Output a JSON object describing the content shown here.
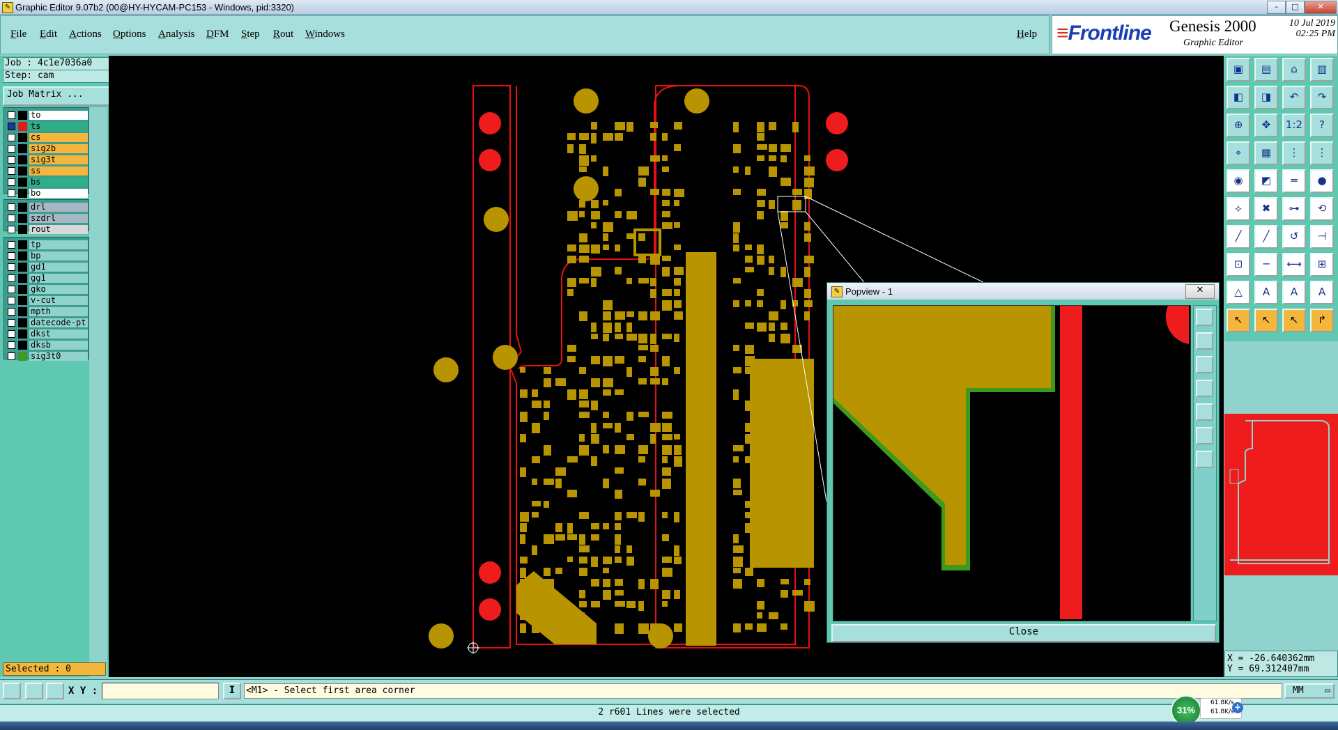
{
  "window": {
    "title": "Graphic Editor 9.07b2 (00@HY-HYCAM-PC153 - Windows, pid:3320)",
    "controls": [
      "–",
      "□",
      "✕"
    ]
  },
  "menu": {
    "items": [
      "File",
      "Edit",
      "Actions",
      "Options",
      "Analysis",
      "DFM",
      "Step",
      "Rout",
      "Windows"
    ],
    "help": "Help"
  },
  "brand": {
    "logo": "Frontline",
    "product": "Genesis 2000",
    "subtitle": "Graphic Editor",
    "date": "10 Jul 2019",
    "time": "02:25 PM"
  },
  "job": {
    "job_line": "Job : 4c1e7036a0",
    "step_line": "Step: cam",
    "matrix_button": "Job Matrix ..."
  },
  "layers": {
    "group1": [
      {
        "name": "to",
        "color": "#ffffff",
        "checked": false,
        "swatch": "#000000"
      },
      {
        "name": "ts",
        "color": "#2fae88",
        "checked": true,
        "swatch": "#e21b1b"
      },
      {
        "name": "cs",
        "color": "#f4b63c",
        "checked": false,
        "swatch": "#000000"
      },
      {
        "name": "sig2b",
        "color": "#f4b63c",
        "checked": false,
        "swatch": "#000000"
      },
      {
        "name": "sig3t",
        "color": "#f4b63c",
        "checked": false,
        "swatch": "#000000"
      },
      {
        "name": "ss",
        "color": "#f4b63c",
        "checked": false,
        "swatch": "#000000"
      },
      {
        "name": "bs",
        "color": "#2fae88",
        "checked": false,
        "swatch": "#000000"
      },
      {
        "name": "bo",
        "color": "#ffffff",
        "checked": false,
        "swatch": "#000000"
      }
    ],
    "group2": [
      {
        "name": "drl",
        "color": "#a6b8c4",
        "checked": false,
        "swatch": "#000000"
      },
      {
        "name": "szdrl",
        "color": "#a6b8c4",
        "checked": false,
        "swatch": "#000000"
      },
      {
        "name": "rout",
        "color": "#d8d8d8",
        "checked": false,
        "swatch": "#000000"
      }
    ],
    "group3": [
      {
        "name": "tp",
        "color": "#8fd3cc",
        "checked": false,
        "swatch": "#000000"
      },
      {
        "name": "bp",
        "color": "#8fd3cc",
        "checked": false,
        "swatch": "#000000"
      },
      {
        "name": "gd1",
        "color": "#8fd3cc",
        "checked": false,
        "swatch": "#000000"
      },
      {
        "name": "gg1",
        "color": "#8fd3cc",
        "checked": false,
        "swatch": "#000000"
      },
      {
        "name": "gko",
        "color": "#8fd3cc",
        "checked": false,
        "swatch": "#000000"
      },
      {
        "name": "v-cut",
        "color": "#8fd3cc",
        "checked": false,
        "swatch": "#000000"
      },
      {
        "name": "mpth",
        "color": "#8fd3cc",
        "checked": false,
        "swatch": "#000000"
      },
      {
        "name": "datecode-pt",
        "color": "#8fd3cc",
        "checked": false,
        "swatch": "#000000"
      },
      {
        "name": "dkst",
        "color": "#8fd3cc",
        "checked": false,
        "swatch": "#000000"
      },
      {
        "name": "dksb",
        "color": "#8fd3cc",
        "checked": false,
        "swatch": "#000000"
      },
      {
        "name": "sig3t0",
        "color": "#8fd3cc",
        "checked": false,
        "swatch": "#3d9a2a"
      }
    ]
  },
  "selected": "Selected : 0",
  "popview": {
    "title": "Popview - 1",
    "close_label": "Close",
    "close_x": "✕"
  },
  "coords": {
    "x": "X = -26.640362mm",
    "y": "Y = 69.312407mm"
  },
  "command": {
    "xy_label": "X Y :",
    "xy_value": "",
    "prompt": "<M1> - Select first area corner",
    "units": "MM"
  },
  "status": "2 r601 Lines were selected",
  "network": {
    "percent": "31%",
    "up": "61.8K/s",
    "down": "61.8K/s"
  },
  "colors": {
    "copper": "#b89400",
    "outline": "#e81010",
    "panel": "#5ec9b0",
    "menu": "#a7dfdc"
  }
}
